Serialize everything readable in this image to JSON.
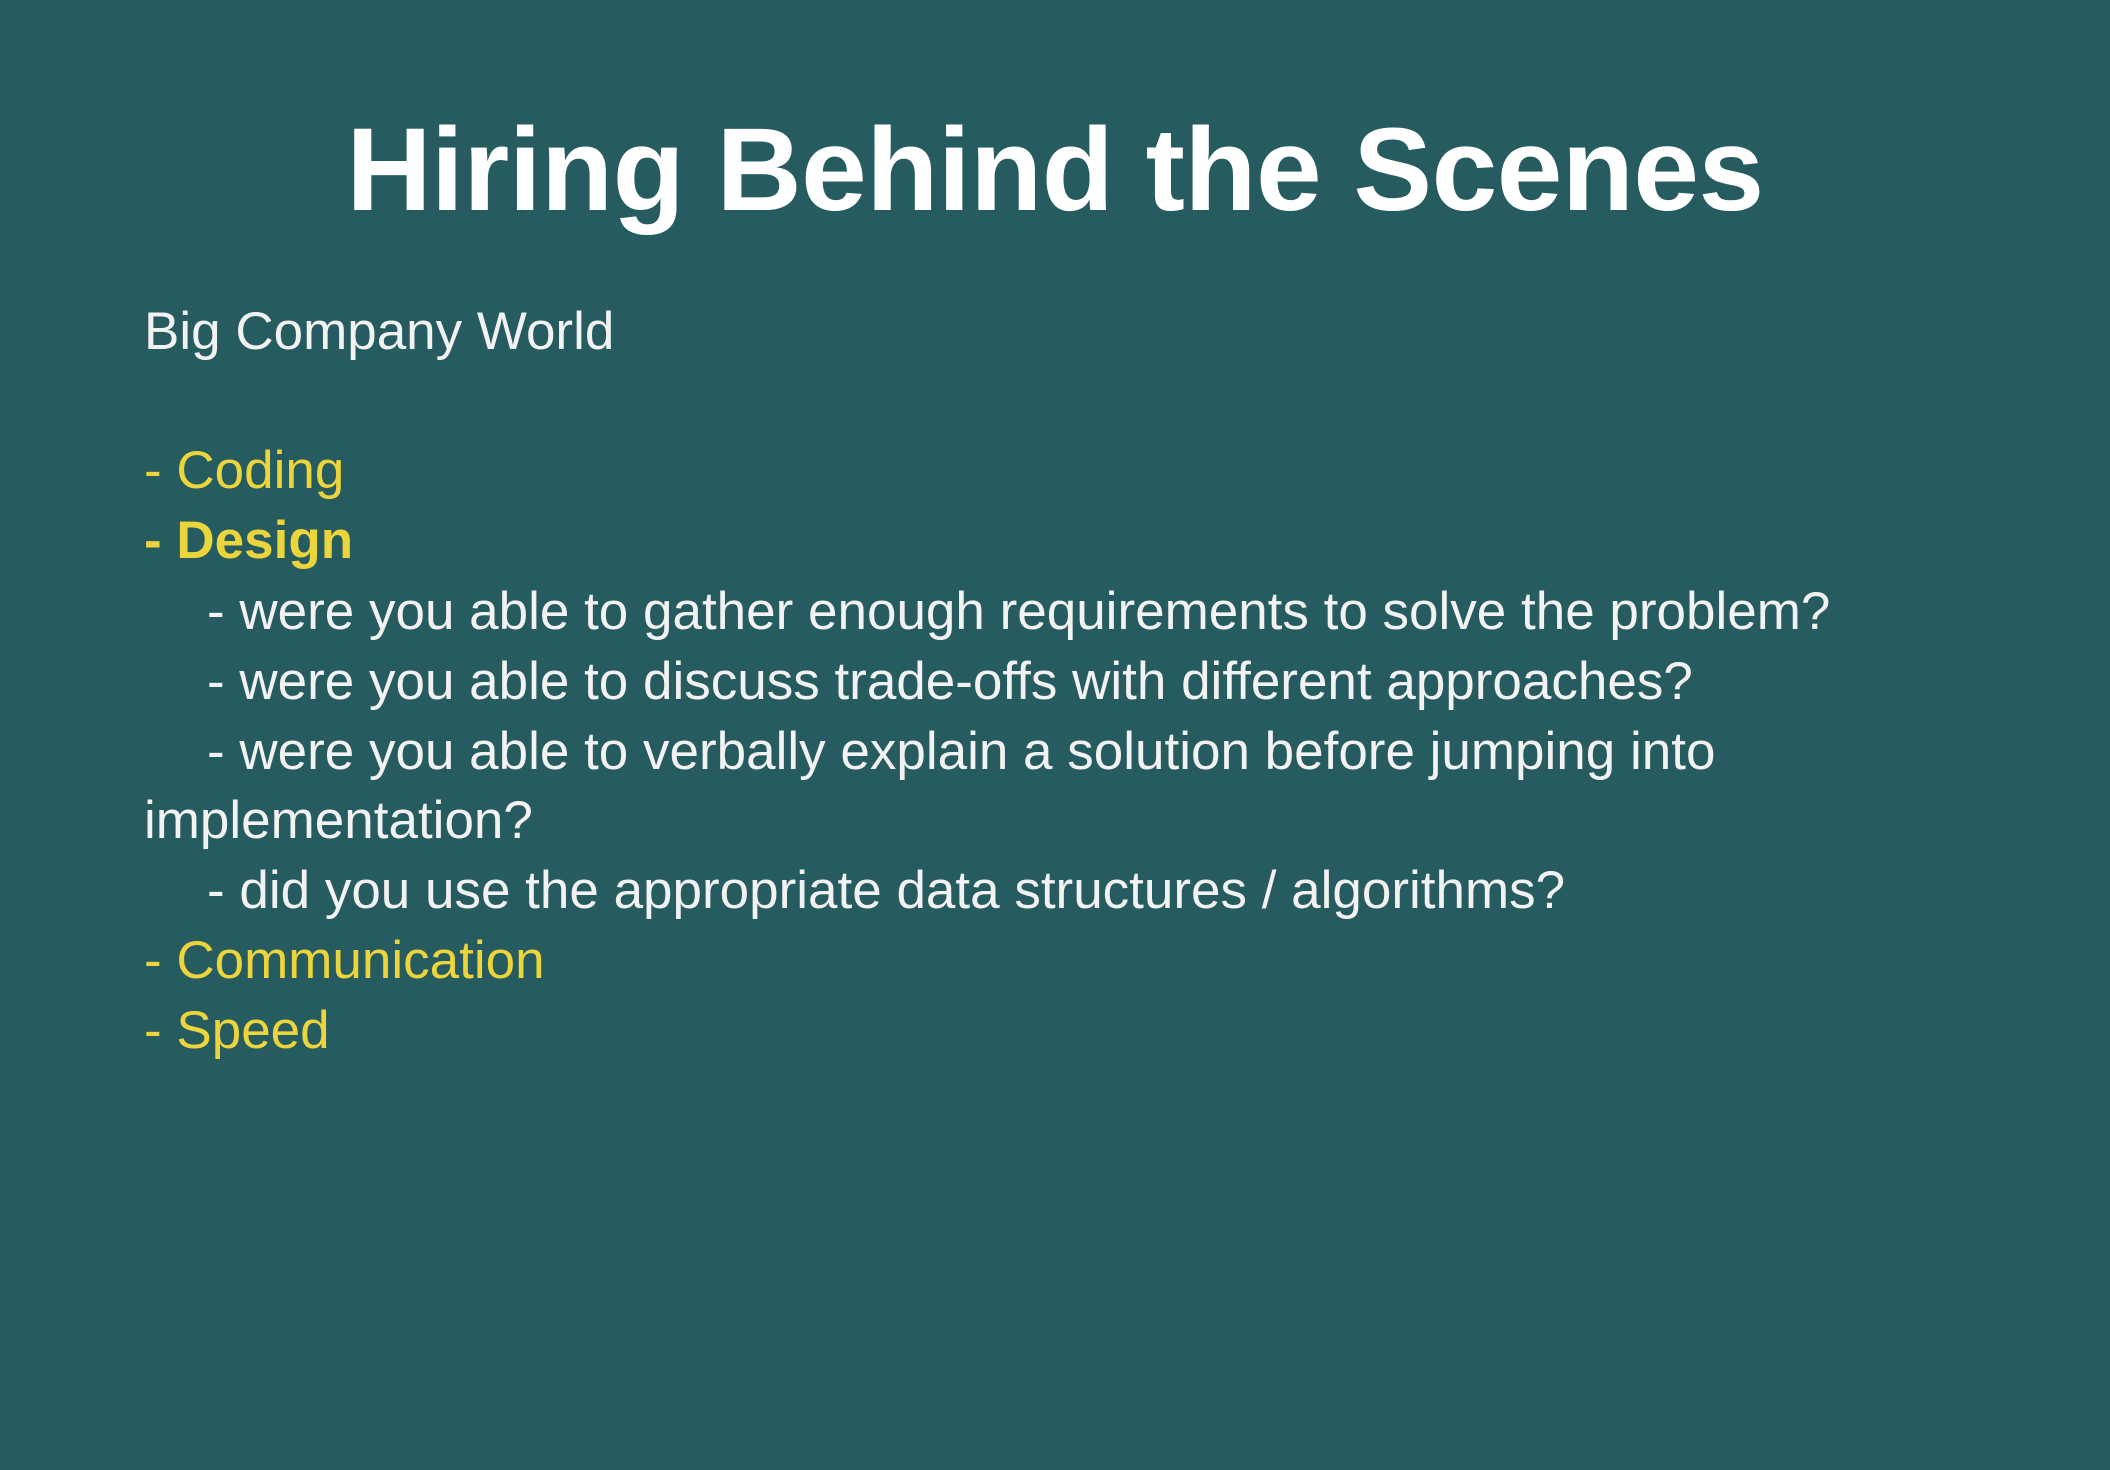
{
  "slide": {
    "title": "Hiring Behind the Scenes",
    "subtitle": "Big Company World",
    "colors": {
      "background": "#265c5f",
      "highlight": "#ecd43c",
      "text": "#f2f2f2"
    },
    "items": [
      {
        "text": "- Coding"
      },
      {
        "text": "- Design"
      },
      {
        "text": "- were you able to gather enough requirements to solve the problem?"
      },
      {
        "text": "- were you able to discuss trade-offs with different approaches?"
      },
      {
        "text": "- were you able to verbally explain a solution before jumping into"
      },
      {
        "text": "implementation?"
      },
      {
        "text": "- did you use the appropriate data structures / algorithms?"
      },
      {
        "text": "- Communication"
      },
      {
        "text": "- Speed"
      }
    ]
  }
}
